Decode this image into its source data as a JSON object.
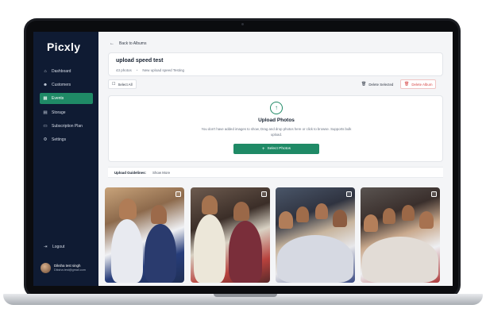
{
  "app": {
    "brand": "Picxly"
  },
  "sidebar": {
    "items": [
      {
        "label": "Dashboard",
        "icon": "home-icon",
        "active": false
      },
      {
        "label": "Customers",
        "icon": "users-icon",
        "active": false
      },
      {
        "label": "Events",
        "icon": "calendar-icon",
        "active": true
      },
      {
        "label": "Storage",
        "icon": "storage-icon",
        "active": false
      },
      {
        "label": "Subscription Plan",
        "icon": "card-icon",
        "active": false
      },
      {
        "label": "Settings",
        "icon": "gear-icon",
        "active": false
      }
    ],
    "logout_label": "Logout",
    "user": {
      "name": "Diksha test singh",
      "email": "Diksha.test@gmail.com"
    }
  },
  "header": {
    "back_label": "Back to Albums"
  },
  "album": {
    "title": "upload speed test",
    "photo_count": "43 photos",
    "description": "New upload speed Testing"
  },
  "toolbar": {
    "select_all_label": "Select All",
    "delete_selected_label": "Delete Selected",
    "delete_album_label": "Delete Album"
  },
  "upload": {
    "title": "Upload Photos",
    "description": "You don't have added images to show, Drag and drop photos here or click to browse. Supports bulk upload.",
    "button_label": "Select Photos"
  },
  "guidelines": {
    "label": "Upload Guidelines:",
    "show_more_label": "Show More"
  },
  "photos": [
    {
      "name": "photo-1"
    },
    {
      "name": "photo-2"
    },
    {
      "name": "photo-3"
    },
    {
      "name": "photo-4"
    }
  ],
  "colors": {
    "sidebar_bg": "#0f1b33",
    "accent_green": "#1f8a66",
    "danger": "#d64545"
  }
}
